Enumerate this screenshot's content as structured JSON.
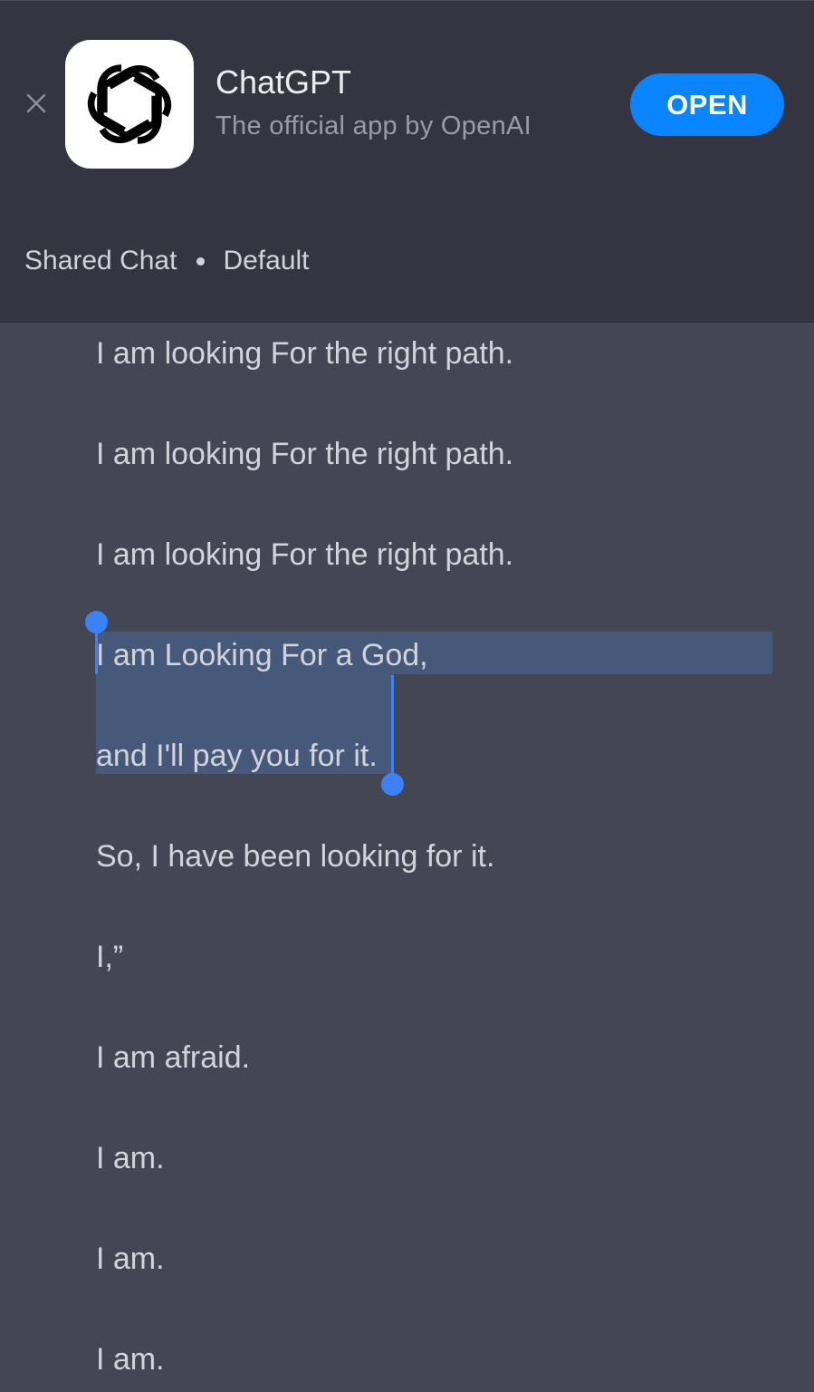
{
  "banner": {
    "close_icon": "close-icon",
    "app_icon": "openai-logo-icon",
    "app_name": "ChatGPT",
    "app_subtitle": "The official app by OpenAI",
    "open_label": "OPEN",
    "open_color": "#0a84ff"
  },
  "header": {
    "title": "Shared Chat",
    "model": "Default"
  },
  "message": {
    "lines": [
      "I am looking For the right path.",
      "I am looking For the right path.",
      "I am looking For the right path.",
      "I am Looking For a God,",
      "and I'll pay you for it.",
      "So, I have been looking for it.",
      "I,”",
      "I am afraid.",
      "I am.",
      "I am.",
      "I am."
    ],
    "selection_color": "#47597a",
    "selection_handle_color": "#3b82f6"
  }
}
